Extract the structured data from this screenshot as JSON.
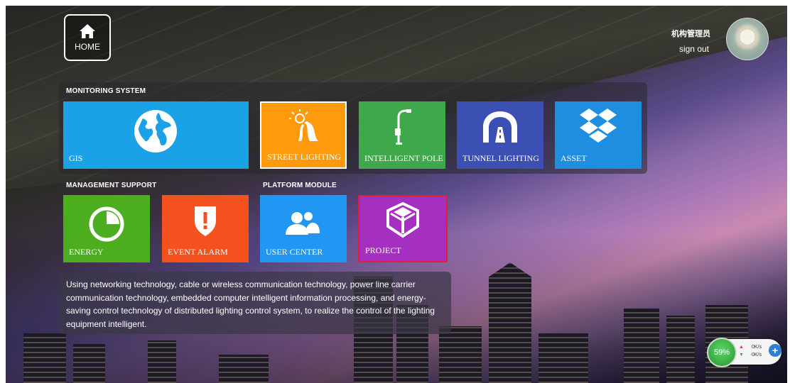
{
  "header": {
    "home_label": "HOME",
    "user_name": "机构管理员",
    "sign_out": "sign out"
  },
  "sections": {
    "monitoring": "MONITORING SYSTEM",
    "management": "MANAGEMENT SUPPORT",
    "platform": "PLATFORM MODULE"
  },
  "tiles": {
    "gis": "GIS",
    "street_lighting": "STREET LIGHTING",
    "intelligent_pole": "INTELLIGENT POLE",
    "tunnel_lighting": "TUNNEL LIGHTING",
    "asset": "ASSET",
    "energy": "ENERGY",
    "event_alarm": "EVENT ALARM",
    "user_center": "USER CENTER",
    "project": "PROJECT"
  },
  "colors": {
    "gis": "#1aa1e6",
    "street_lighting": "#ff9a0d",
    "intelligent_pole": "#3fa84a",
    "tunnel_lighting": "#3c4fb3",
    "asset": "#1f8ee0",
    "energy": "#4cae1f",
    "event_alarm": "#f4511e",
    "user_center": "#2196f3",
    "project": "#a52fc1"
  },
  "description": "Using networking technology, cable or wireless communication technology, power line carrier communication technology, embedded computer intelligent information processing, and energy-saving control technology of distributed lighting control system, to realize the control of the lighting equipment intelligent.",
  "speed_widget": {
    "percent": "59%",
    "up_rate": "0K/s",
    "down_rate": "0K/s",
    "plus": "+"
  }
}
